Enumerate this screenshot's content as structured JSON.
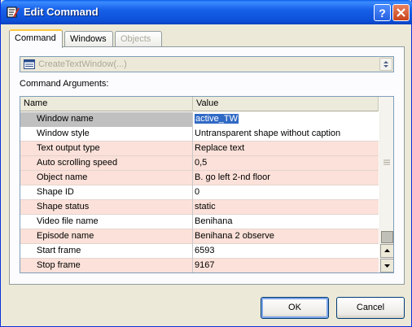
{
  "window": {
    "title": "Edit Command"
  },
  "tabs": [
    {
      "label": "Command",
      "state": "active"
    },
    {
      "label": "Windows",
      "state": "normal"
    },
    {
      "label": "Objects",
      "state": "disabled"
    }
  ],
  "command_select": {
    "value": "CreateTextWindow(...)",
    "icon": "window-icon"
  },
  "arguments": {
    "label": "Command Arguments:",
    "columns": [
      "Name",
      "Value"
    ],
    "rows": [
      {
        "name": "Window name",
        "value": "active_TW",
        "selected": true
      },
      {
        "name": "Window style",
        "value": "Untransparent shape without caption"
      },
      {
        "name": "Text output type",
        "value": "Replace text"
      },
      {
        "name": "Auto scrolling speed",
        "value": "0,5"
      },
      {
        "name": "Object name",
        "value": "B. go left 2-nd floor"
      },
      {
        "name": "Shape ID",
        "value": "0"
      },
      {
        "name": "Shape status",
        "value": "static"
      },
      {
        "name": "Video file name",
        "value": "Benihana"
      },
      {
        "name": "Episode name",
        "value": "Benihana 2 observe"
      },
      {
        "name": "Start frame",
        "value": "6593"
      },
      {
        "name": "Stop frame",
        "value": "9167"
      }
    ]
  },
  "buttons": {
    "ok": "OK",
    "cancel": "Cancel"
  },
  "colors": {
    "titlebar": "#0d50d8",
    "row_alt": "#fbe1d9",
    "selection": "#316ac5"
  }
}
